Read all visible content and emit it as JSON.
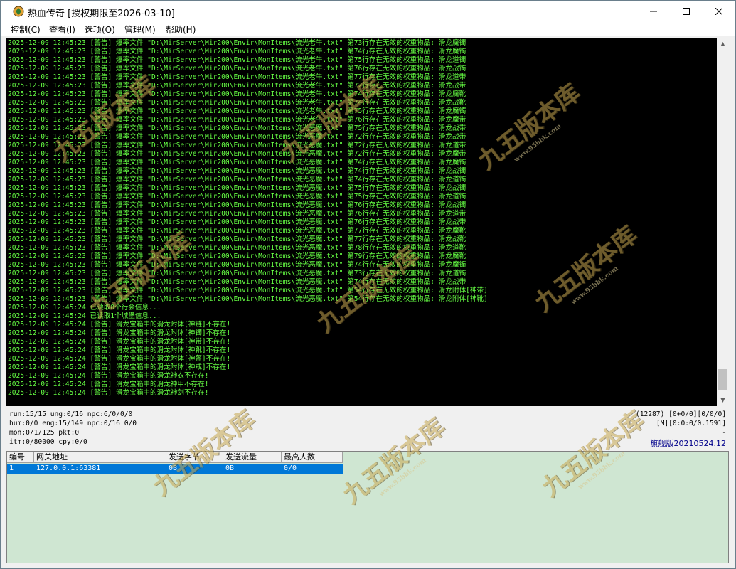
{
  "window": {
    "title": "热血传奇 [授权期限至2026-03-10]",
    "controls": {
      "minimize": "—",
      "maximize": "☐",
      "close": "✕"
    }
  },
  "menu": [
    "控制(C)",
    "查看(I)",
    "选项(O)",
    "管理(M)",
    "帮助(H)"
  ],
  "console": {
    "lines": [
      "2025-12-09 12:45:23 [警告] 爆率文件 \"D:\\MirServer\\Mir200\\Envir\\MonItems\\流光老牛.txt\" 第73行存在无效的权重物品: 滑龙魔镯",
      "2025-12-09 12:45:23 [警告] 爆率文件 \"D:\\MirServer\\Mir200\\Envir\\MonItems\\流光老牛.txt\" 第74行存在无效的权重物品: 滑龙魔镯",
      "2025-12-09 12:45:23 [警告] 爆率文件 \"D:\\MirServer\\Mir200\\Envir\\MonItems\\流光老牛.txt\" 第75行存在无效的权重物品: 滑龙道镯",
      "2025-12-09 12:45:23 [警告] 爆率文件 \"D:\\MirServer\\Mir200\\Envir\\MonItems\\流光老牛.txt\" 第76行存在无效的权重物品: 滑龙战镯",
      "2025-12-09 12:45:23 [警告] 爆率文件 \"D:\\MirServer\\Mir200\\Envir\\MonItems\\流光老牛.txt\" 第77行存在无效的权重物品: 滑龙道带",
      "2025-12-09 12:45:23 [警告] 爆率文件 \"D:\\MirServer\\Mir200\\Envir\\MonItems\\流光老牛.txt\" 第72行存在无效的权重物品: 滑龙战带",
      "2025-12-09 12:45:23 [警告] 爆率文件 \"D:\\MirServer\\Mir200\\Envir\\MonItems\\流光老牛.txt\" 第74行存在无效的权重物品: 滑龙魔靴",
      "2025-12-09 12:45:23 [警告] 爆率文件 \"D:\\MirServer\\Mir200\\Envir\\MonItems\\流光老牛.txt\" 第74行存在无效的权重物品: 滑龙战靴",
      "2025-12-09 12:45:23 [警告] 爆率文件 \"D:\\MirServer\\Mir200\\Envir\\MonItems\\流光老牛.txt\" 第75行存在无效的权重物品: 滑龙魔镯",
      "2025-12-09 12:45:23 [警告] 爆率文件 \"D:\\MirServer\\Mir200\\Envir\\MonItems\\流光老牛.txt\" 第76行存在无效的权重物品: 滑龙魔带",
      "2025-12-09 12:45:23 [警告] 爆率文件 \"D:\\MirServer\\Mir200\\Envir\\MonItems\\流光恶魔.txt\" 第75行存在无效的权重物品: 滑龙战带",
      "2025-12-09 12:45:23 [警告] 爆率文件 \"D:\\MirServer\\Mir200\\Envir\\MonItems\\流光恶魔.txt\" 第72行存在无效的权重物品: 滑龙战带",
      "2025-12-09 12:45:23 [警告] 爆率文件 \"D:\\MirServer\\Mir200\\Envir\\MonItems\\流光恶魔.txt\" 第72行存在无效的权重物品: 滑龙道带",
      "2025-12-09 12:45:23 [警告] 爆率文件 \"D:\\MirServer\\Mir200\\Envir\\MonItems\\流光恶魔.txt\" 第72行存在无效的权重物品: 滑龙魔带",
      "2025-12-09 12:45:23 [警告] 爆率文件 \"D:\\MirServer\\Mir200\\Envir\\MonItems\\流光恶魔.txt\" 第74行存在无效的权重物品: 滑龙魔镯",
      "2025-12-09 12:45:23 [警告] 爆率文件 \"D:\\MirServer\\Mir200\\Envir\\MonItems\\流光恶魔.txt\" 第74行存在无效的权重物品: 滑龙战镯",
      "2025-12-09 12:45:23 [警告] 爆率文件 \"D:\\MirServer\\Mir200\\Envir\\MonItems\\流光恶魔.txt\" 第74行存在无效的权重物品: 滑龙道镯",
      "2025-12-09 12:45:23 [警告] 爆率文件 \"D:\\MirServer\\Mir200\\Envir\\MonItems\\流光恶魔.txt\" 第75行存在无效的权重物品: 滑龙战镯",
      "2025-12-09 12:45:23 [警告] 爆率文件 \"D:\\MirServer\\Mir200\\Envir\\MonItems\\流光恶魔.txt\" 第75行存在无效的权重物品: 滑龙道镯",
      "2025-12-09 12:45:23 [警告] 爆率文件 \"D:\\MirServer\\Mir200\\Envir\\MonItems\\流光恶魔.txt\" 第76行存在无效的权重物品: 滑龙战镯",
      "2025-12-09 12:45:23 [警告] 爆率文件 \"D:\\MirServer\\Mir200\\Envir\\MonItems\\流光恶魔.txt\" 第76行存在无效的权重物品: 滑龙道带",
      "2025-12-09 12:45:23 [警告] 爆率文件 \"D:\\MirServer\\Mir200\\Envir\\MonItems\\流光恶魔.txt\" 第76行存在无效的权重物品: 滑龙战带",
      "2025-12-09 12:45:23 [警告] 爆率文件 \"D:\\MirServer\\Mir200\\Envir\\MonItems\\流光恶魔.txt\" 第77行存在无效的权重物品: 滑龙魔靴",
      "2025-12-09 12:45:23 [警告] 爆率文件 \"D:\\MirServer\\Mir200\\Envir\\MonItems\\流光恶魔.txt\" 第77行存在无效的权重物品: 滑龙战靴",
      "2025-12-09 12:45:23 [警告] 爆率文件 \"D:\\MirServer\\Mir200\\Envir\\MonItems\\流光恶魔.txt\" 第78行存在无效的权重物品: 滑龙道靴",
      "2025-12-09 12:45:23 [警告] 爆率文件 \"D:\\MirServer\\Mir200\\Envir\\MonItems\\流光恶魔.txt\" 第79行存在无效的权重物品: 滑龙魔靴",
      "2025-12-09 12:45:23 [警告] 爆率文件 \"D:\\MirServer\\Mir200\\Envir\\MonItems\\流光恶魔.txt\" 第74行存在无效的权重物品: 滑龙魔镯",
      "2025-12-09 12:45:23 [警告] 爆率文件 \"D:\\MirServer\\Mir200\\Envir\\MonItems\\流光恶魔.txt\" 第73行存在无效的权重物品: 滑龙道镯",
      "2025-12-09 12:45:23 [警告] 爆率文件 \"D:\\MirServer\\Mir200\\Envir\\MonItems\\流光恶魔.txt\" 第74行存在无效的权重物品: 滑龙战带",
      "2025-12-09 12:45:23 [警告] 爆率文件 \"D:\\MirServer\\Mir200\\Envir\\MonItems\\流光恶魔.txt\" 第54行存在无效的权重物品: 滑龙附体[神带]",
      "2025-12-09 12:45:23 [警告] 爆率文件 \"D:\\MirServer\\Mir200\\Envir\\MonItems\\流光恶魔.txt\" 第54行存在无效的权重物品: 滑龙附体[神靴]",
      "2025-12-09 12:45:24 已读取0个行会信息...",
      "2025-12-09 12:45:24 已读取1个城堡信息...",
      "2025-12-09 12:45:24 [警告] 滑龙宝箱中的滑龙附体[神链]不存在!",
      "2025-12-09 12:45:24 [警告] 滑龙宝箱中的滑龙附体[神镯]不存在!",
      "2025-12-09 12:45:24 [警告] 滑龙宝箱中的滑龙附体[神带]不存在!",
      "2025-12-09 12:45:24 [警告] 滑龙宝箱中的滑龙附体[神靴]不存在!",
      "2025-12-09 12:45:24 [警告] 滑龙宝箱中的滑龙附体[神盔]不存在!",
      "2025-12-09 12:45:24 [警告] 滑龙宝箱中的滑龙附体[神戒]不存在!",
      "2025-12-09 12:45:24 [警告] 滑龙宝箱中的滑龙神衣不存在!",
      "2025-12-09 12:45:24 [警告] 滑龙宝箱中的滑龙神甲不存在!",
      "2025-12-09 12:45:24 [警告] 滑龙宝箱中的滑龙神剑不存在!"
    ]
  },
  "status": {
    "line1": "run:15/15 ung:0/16 npc:6/0/0/0",
    "line2": "hum:0/0 eng:15/149 npc:0/16 0/0",
    "line3": "mon:0/1/125 pkt:0",
    "line4": "itm:0/80000 cpy:0/0",
    "right1": "(12287) [0+0/0][0/0/0]",
    "right2": "[M][0:0:0/0.1591]",
    "right3": "-",
    "version": "旗舰版20210524.12"
  },
  "gate_table": {
    "headers": [
      "编号",
      "网关地址",
      "发送字节",
      "发送流量",
      "最高人数"
    ],
    "rows": [
      [
        "1",
        "127.0.0.1:63381",
        "0B",
        "0B",
        "0/0"
      ]
    ]
  },
  "watermark": {
    "text": "九五版本库",
    "url": "www.95bbk.com"
  },
  "colors": {
    "console_bg": "#000000",
    "console_text": "#66ff44",
    "gate_bg": "#cfe6d2",
    "selection": "#0078d7"
  }
}
